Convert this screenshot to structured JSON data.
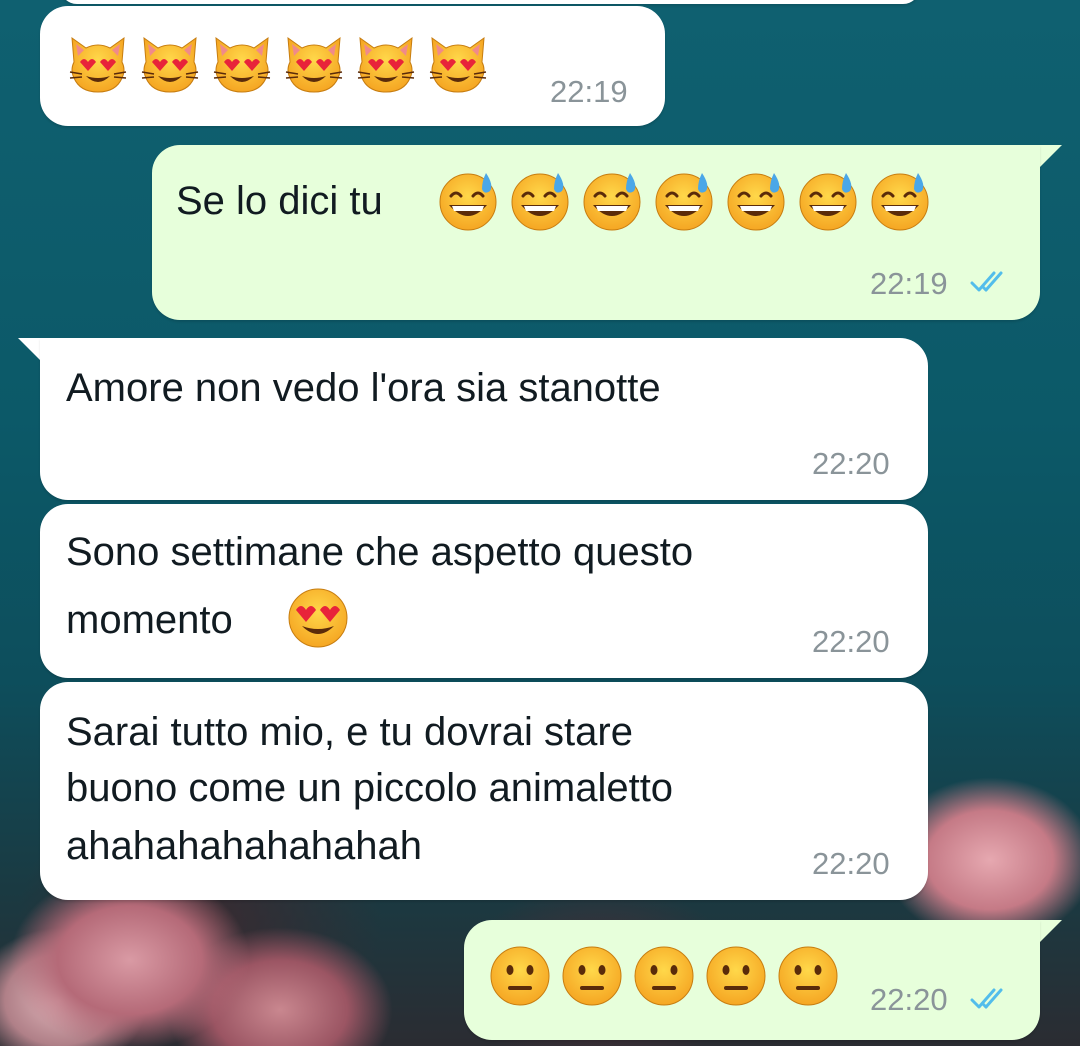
{
  "chat": {
    "messages": [
      {
        "direction": "incoming",
        "emoji": [
          "heart-eyes-cat",
          "heart-eyes-cat",
          "heart-eyes-cat",
          "heart-eyes-cat",
          "heart-eyes-cat",
          "heart-eyes-cat"
        ],
        "time": "22:19"
      },
      {
        "direction": "outgoing",
        "text": "Se lo dici tu",
        "emoji": [
          "grinning-sweat",
          "grinning-sweat",
          "grinning-sweat",
          "grinning-sweat",
          "grinning-sweat",
          "grinning-sweat",
          "grinning-sweat"
        ],
        "time": "22:19",
        "status": "read"
      },
      {
        "direction": "incoming",
        "text": "Amore non vedo l'ora sia stanotte",
        "time": "22:20"
      },
      {
        "direction": "incoming",
        "text_line1": "Sono settimane che aspetto questo",
        "text_line2": "momento",
        "emoji": [
          "heart-eyes"
        ],
        "time": "22:20"
      },
      {
        "direction": "incoming",
        "text_line1": "Sarai tutto mio, e tu dovrai stare",
        "text_line2": "buono come un piccolo animaletto",
        "text_line3": "ahahahahahahahah",
        "time": "22:20"
      },
      {
        "direction": "outgoing",
        "emoji": [
          "neutral-face",
          "neutral-face",
          "neutral-face",
          "neutral-face",
          "neutral-face"
        ],
        "time": "22:20",
        "status": "read"
      }
    ]
  },
  "colors": {
    "incoming_bubble": "#ffffff",
    "outgoing_bubble": "#e7ffdb",
    "read_ticks": "#53bdeb",
    "timestamp": "#8a9499"
  }
}
